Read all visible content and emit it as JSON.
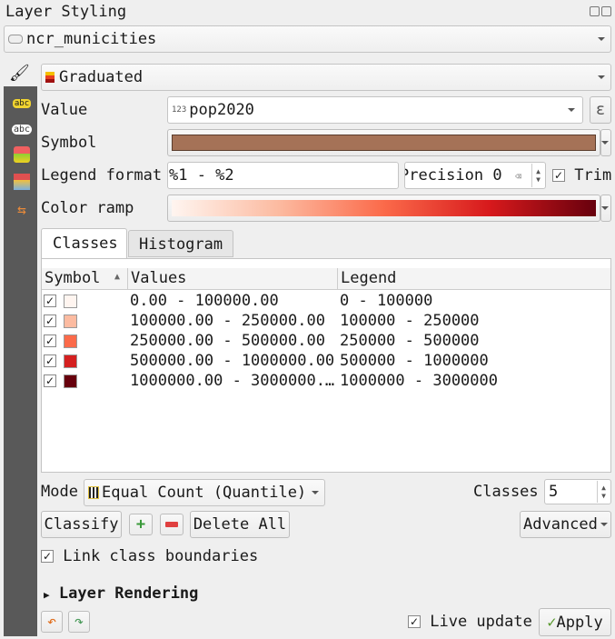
{
  "panel": {
    "title": "Layer Styling"
  },
  "layer": {
    "name": "ncr_municities"
  },
  "renderer": {
    "type": "Graduated"
  },
  "form": {
    "value_label": "Value",
    "value_type_badge": "123",
    "value": "pop2020",
    "expression_button": "ε",
    "symbol_label": "Symbol",
    "symbol_color": "#a57257",
    "legend_format_label": "Legend format",
    "legend_format": "%1 - %2",
    "precision": "Precision 0",
    "trim_label": "Trim",
    "trim_checked": true,
    "color_ramp_label": "Color ramp",
    "color_ramp": [
      "#fff5f0",
      "#fcbba1",
      "#fb6a4a",
      "#d7191c",
      "#67000d"
    ]
  },
  "tabs": [
    {
      "label": "Classes",
      "active": true
    },
    {
      "label": "Histogram",
      "active": false
    }
  ],
  "table": {
    "columns": [
      "Symbol",
      "Values",
      "Legend"
    ],
    "rows": [
      {
        "checked": true,
        "color": "#fff5f0",
        "values": "0.00 - 100000.00",
        "legend": "0 - 100000"
      },
      {
        "checked": true,
        "color": "#fcbba1",
        "values": "100000.00 - 250000.00",
        "legend": "100000 - 250000"
      },
      {
        "checked": true,
        "color": "#fb6a4a",
        "values": "250000.00 - 500000.00",
        "legend": "250000 - 500000"
      },
      {
        "checked": true,
        "color": "#d42020",
        "values": "500000.00 - 1000000.00",
        "legend": "500000 - 1000000"
      },
      {
        "checked": true,
        "color": "#67000d",
        "values": "1000000.00 - 3000000.…",
        "legend": "1000000 - 3000000"
      }
    ]
  },
  "mode": {
    "label": "Mode",
    "value": "Equal Count (Quantile)",
    "classes_label": "Classes",
    "classes": "5"
  },
  "buttons": {
    "classify": "Classify",
    "delete_all": "Delete All",
    "advanced": "Advanced",
    "apply": "Apply"
  },
  "link_boundaries": {
    "label": "Link class boundaries",
    "checked": true
  },
  "layer_rendering": "Layer Rendering",
  "live_update": {
    "label": "Live update",
    "checked": true
  },
  "check_mark": "✓"
}
